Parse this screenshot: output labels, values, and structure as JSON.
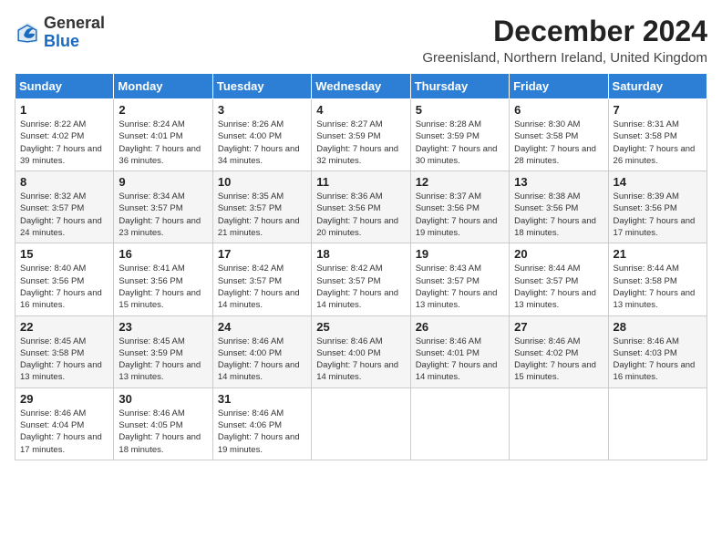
{
  "logo": {
    "general": "General",
    "blue": "Blue"
  },
  "title": "December 2024",
  "subtitle": "Greenisland, Northern Ireland, United Kingdom",
  "weekdays": [
    "Sunday",
    "Monday",
    "Tuesday",
    "Wednesday",
    "Thursday",
    "Friday",
    "Saturday"
  ],
  "weeks": [
    [
      {
        "day": "1",
        "sunrise": "8:22 AM",
        "sunset": "4:02 PM",
        "daylight": "7 hours and 39 minutes."
      },
      {
        "day": "2",
        "sunrise": "8:24 AM",
        "sunset": "4:01 PM",
        "daylight": "7 hours and 36 minutes."
      },
      {
        "day": "3",
        "sunrise": "8:26 AM",
        "sunset": "4:00 PM",
        "daylight": "7 hours and 34 minutes."
      },
      {
        "day": "4",
        "sunrise": "8:27 AM",
        "sunset": "3:59 PM",
        "daylight": "7 hours and 32 minutes."
      },
      {
        "day": "5",
        "sunrise": "8:28 AM",
        "sunset": "3:59 PM",
        "daylight": "7 hours and 30 minutes."
      },
      {
        "day": "6",
        "sunrise": "8:30 AM",
        "sunset": "3:58 PM",
        "daylight": "7 hours and 28 minutes."
      },
      {
        "day": "7",
        "sunrise": "8:31 AM",
        "sunset": "3:58 PM",
        "daylight": "7 hours and 26 minutes."
      }
    ],
    [
      {
        "day": "8",
        "sunrise": "8:32 AM",
        "sunset": "3:57 PM",
        "daylight": "7 hours and 24 minutes."
      },
      {
        "day": "9",
        "sunrise": "8:34 AM",
        "sunset": "3:57 PM",
        "daylight": "7 hours and 23 minutes."
      },
      {
        "day": "10",
        "sunrise": "8:35 AM",
        "sunset": "3:57 PM",
        "daylight": "7 hours and 21 minutes."
      },
      {
        "day": "11",
        "sunrise": "8:36 AM",
        "sunset": "3:56 PM",
        "daylight": "7 hours and 20 minutes."
      },
      {
        "day": "12",
        "sunrise": "8:37 AM",
        "sunset": "3:56 PM",
        "daylight": "7 hours and 19 minutes."
      },
      {
        "day": "13",
        "sunrise": "8:38 AM",
        "sunset": "3:56 PM",
        "daylight": "7 hours and 18 minutes."
      },
      {
        "day": "14",
        "sunrise": "8:39 AM",
        "sunset": "3:56 PM",
        "daylight": "7 hours and 17 minutes."
      }
    ],
    [
      {
        "day": "15",
        "sunrise": "8:40 AM",
        "sunset": "3:56 PM",
        "daylight": "7 hours and 16 minutes."
      },
      {
        "day": "16",
        "sunrise": "8:41 AM",
        "sunset": "3:56 PM",
        "daylight": "7 hours and 15 minutes."
      },
      {
        "day": "17",
        "sunrise": "8:42 AM",
        "sunset": "3:57 PM",
        "daylight": "7 hours and 14 minutes."
      },
      {
        "day": "18",
        "sunrise": "8:42 AM",
        "sunset": "3:57 PM",
        "daylight": "7 hours and 14 minutes."
      },
      {
        "day": "19",
        "sunrise": "8:43 AM",
        "sunset": "3:57 PM",
        "daylight": "7 hours and 13 minutes."
      },
      {
        "day": "20",
        "sunrise": "8:44 AM",
        "sunset": "3:57 PM",
        "daylight": "7 hours and 13 minutes."
      },
      {
        "day": "21",
        "sunrise": "8:44 AM",
        "sunset": "3:58 PM",
        "daylight": "7 hours and 13 minutes."
      }
    ],
    [
      {
        "day": "22",
        "sunrise": "8:45 AM",
        "sunset": "3:58 PM",
        "daylight": "7 hours and 13 minutes."
      },
      {
        "day": "23",
        "sunrise": "8:45 AM",
        "sunset": "3:59 PM",
        "daylight": "7 hours and 13 minutes."
      },
      {
        "day": "24",
        "sunrise": "8:46 AM",
        "sunset": "4:00 PM",
        "daylight": "7 hours and 14 minutes."
      },
      {
        "day": "25",
        "sunrise": "8:46 AM",
        "sunset": "4:00 PM",
        "daylight": "7 hours and 14 minutes."
      },
      {
        "day": "26",
        "sunrise": "8:46 AM",
        "sunset": "4:01 PM",
        "daylight": "7 hours and 14 minutes."
      },
      {
        "day": "27",
        "sunrise": "8:46 AM",
        "sunset": "4:02 PM",
        "daylight": "7 hours and 15 minutes."
      },
      {
        "day": "28",
        "sunrise": "8:46 AM",
        "sunset": "4:03 PM",
        "daylight": "7 hours and 16 minutes."
      }
    ],
    [
      {
        "day": "29",
        "sunrise": "8:46 AM",
        "sunset": "4:04 PM",
        "daylight": "7 hours and 17 minutes."
      },
      {
        "day": "30",
        "sunrise": "8:46 AM",
        "sunset": "4:05 PM",
        "daylight": "7 hours and 18 minutes."
      },
      {
        "day": "31",
        "sunrise": "8:46 AM",
        "sunset": "4:06 PM",
        "daylight": "7 hours and 19 minutes."
      },
      null,
      null,
      null,
      null
    ]
  ]
}
